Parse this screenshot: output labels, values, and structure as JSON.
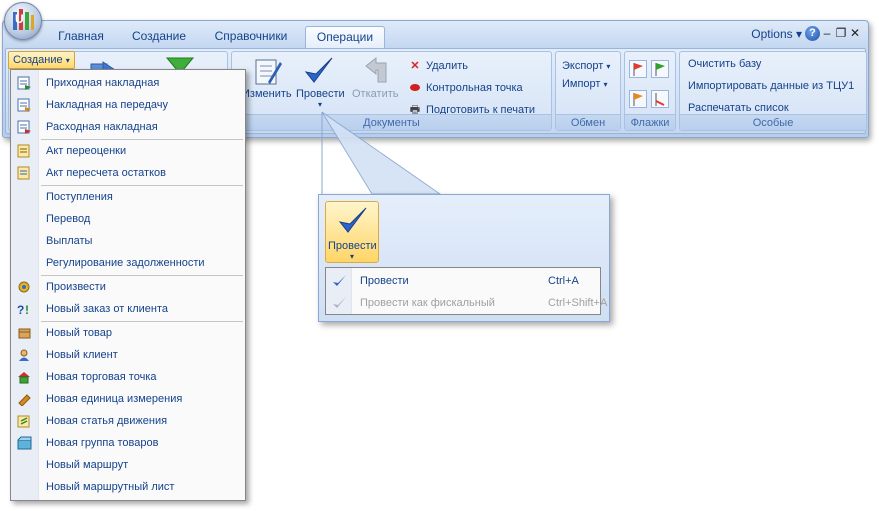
{
  "tabs": [
    {
      "label": "Главная",
      "active": false
    },
    {
      "label": "Создание",
      "active": false
    },
    {
      "label": "Справочники",
      "active": false
    },
    {
      "label": "Операции",
      "active": true
    }
  ],
  "titlebar": {
    "options_label": "Options",
    "help_icon": "help-icon",
    "minimize_icon": "minimize-icon",
    "restore_icon": "restore-icon",
    "close_icon": "close-icon"
  },
  "create_button": {
    "label": "Создание"
  },
  "documents_group": {
    "label": "Документы",
    "change_label": "Изменить",
    "post_label": "Провести",
    "rollback_label": "Откатить",
    "delete_label": "Удалить",
    "checkpoint_label": "Контрольная точка",
    "print_label": "Подготовить к печати"
  },
  "exchange_group": {
    "label": "Обмен",
    "export_label": "Экспорт",
    "import_label": "Импорт"
  },
  "flags_group": {
    "label": "Флажки"
  },
  "special_group": {
    "label": "Особые",
    "clear_label": "Очистить базу",
    "import_data_label": "Импортировать данные из ТЦУ1",
    "print_list_label": "Распечатать список"
  },
  "menu": {
    "items": [
      {
        "label": "Приходная накладная",
        "icon": "incoming-invoice-icon"
      },
      {
        "label": "Накладная на передачу",
        "icon": "transfer-invoice-icon"
      },
      {
        "label": "Расходная накладная",
        "icon": "outgoing-invoice-icon"
      },
      {
        "label": "Акт переоценки",
        "icon": "revaluation-icon"
      },
      {
        "label": "Акт пересчета остатков",
        "icon": "recount-icon"
      },
      {
        "label": "Поступления",
        "icon": ""
      },
      {
        "label": "Перевод",
        "icon": ""
      },
      {
        "label": "Выплаты",
        "icon": ""
      },
      {
        "label": "Регулирование задолженности",
        "icon": ""
      },
      {
        "label": "Произвести",
        "icon": "produce-icon"
      },
      {
        "label": "Новый заказ от клиента",
        "icon": "client-order-icon"
      },
      {
        "label": "Новый товар",
        "icon": "product-icon"
      },
      {
        "label": "Новый клиент",
        "icon": "client-icon"
      },
      {
        "label": "Новая торговая точка",
        "icon": "store-icon"
      },
      {
        "label": "Новая единица измерения",
        "icon": "unit-icon"
      },
      {
        "label": "Новая статья движения",
        "icon": "movement-icon"
      },
      {
        "label": "Новая группа товаров",
        "icon": "product-group-icon"
      },
      {
        "label": "Новый маршрут",
        "icon": ""
      },
      {
        "label": "Новый маршрутный лист",
        "icon": ""
      }
    ]
  },
  "popup": {
    "button_label": "Провести",
    "items": [
      {
        "label": "Провести",
        "shortcut": "Ctrl+A",
        "enabled": true
      },
      {
        "label": "Провести как фискальный",
        "shortcut": "Ctrl+Shift+A",
        "enabled": false
      }
    ]
  },
  "colors": {
    "accent": "#15428b",
    "highlight": "#ffd566",
    "disabled": "#a0a0a0"
  }
}
